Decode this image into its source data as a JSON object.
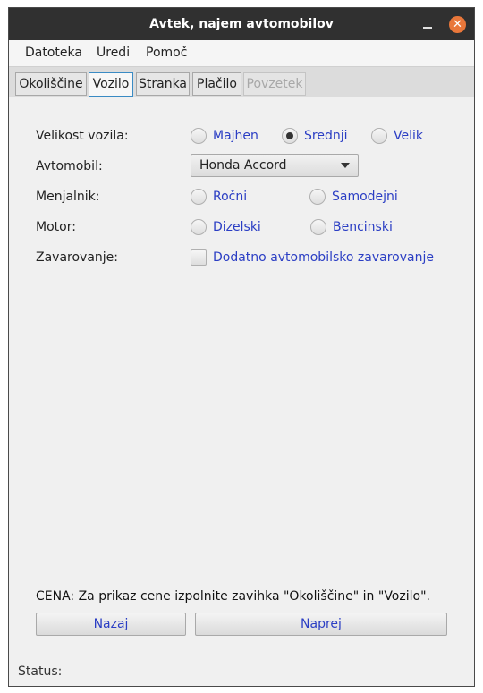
{
  "window": {
    "title": "Avtek, najem avtomobilov",
    "close_glyph": "✕",
    "min_icon": "minimize-icon",
    "close_icon": "close-icon"
  },
  "menu": [
    "Datoteka",
    "Uredi",
    "Pomoč"
  ],
  "tabs": [
    {
      "label": "Okoliščine",
      "state": "normal"
    },
    {
      "label": "Vozilo",
      "state": "active"
    },
    {
      "label": "Stranka",
      "state": "normal"
    },
    {
      "label": "Plačilo",
      "state": "normal"
    },
    {
      "label": "Povzetek",
      "state": "disabled"
    }
  ],
  "form": {
    "size": {
      "label": "Velikost vozila:",
      "options": [
        "Majhen",
        "Srednji",
        "Velik"
      ],
      "selected": "Srednji"
    },
    "car": {
      "label": "Avtomobil:",
      "value": "Honda Accord"
    },
    "transmission": {
      "label": "Menjalnik:",
      "options": [
        "Ročni",
        "Samodejni"
      ],
      "selected": null
    },
    "engine": {
      "label": "Motor:",
      "options": [
        "Dizelski",
        "Bencinski"
      ],
      "selected": null
    },
    "insurance": {
      "label": "Zavarovanje:",
      "checkbox_label": "Dodatno avtomobilsko zavarovanje",
      "checked": false
    }
  },
  "price_text": "CENA: Za prikaz cene izpolnite zavihka \"Okoliščine\" in \"Vozilo\".",
  "buttons": {
    "back": "Nazaj",
    "next": "Naprej"
  },
  "status": "Status:",
  "colors": {
    "titlebar": "#303030",
    "close": "#e9773a",
    "option_text": "#2b3ec4",
    "active_tab_border": "#3a8bc4"
  }
}
